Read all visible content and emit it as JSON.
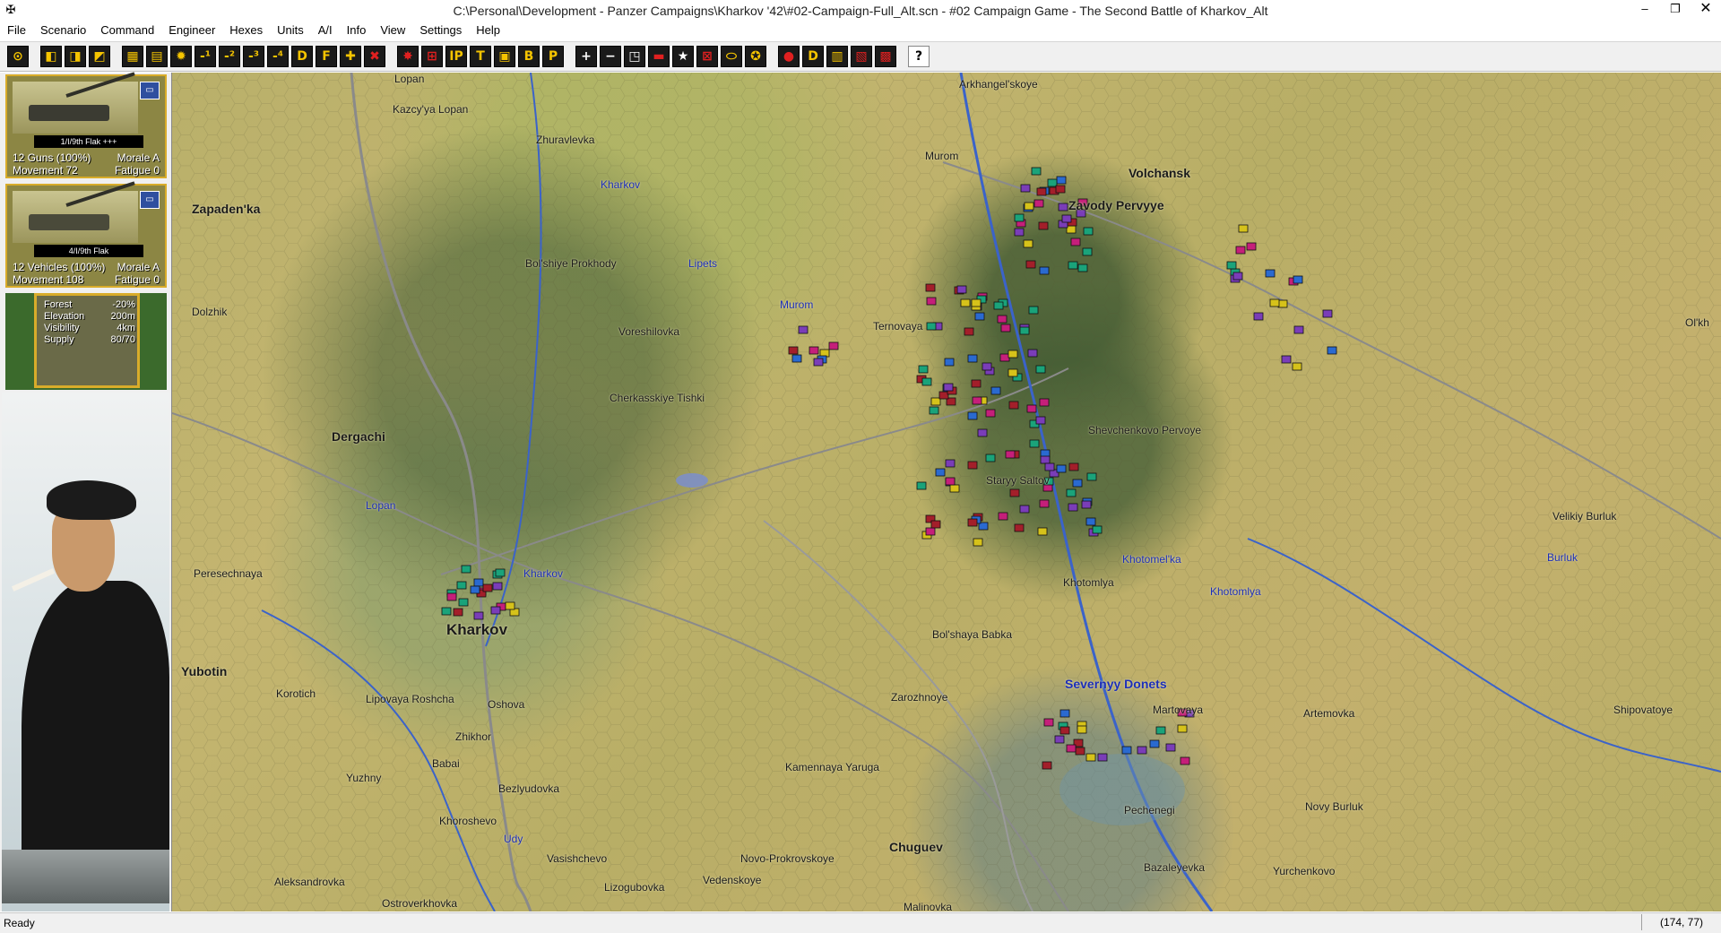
{
  "window": {
    "title": "C:\\Personal\\Development - Panzer Campaigns\\Kharkov '42\\#02-Campaign-Full_Alt.scn - #02 Campaign Game - The Second Battle of Kharkov_Alt",
    "minimize": "–",
    "restore": "❐",
    "close": "✕"
  },
  "menu": [
    "File",
    "Scenario",
    "Command",
    "Engineer",
    "Hexes",
    "Units",
    "A/I",
    "Info",
    "View",
    "Settings",
    "Help"
  ],
  "toolbar": {
    "group1": [
      "⊙",
      "◧",
      "◨",
      "◩",
      "▦",
      "▤",
      "✹",
      "-¹",
      "-²",
      "-³",
      "-⁴",
      "D",
      "F",
      "✚",
      "✖"
    ],
    "group2": [
      "✸",
      "⊞",
      "IP",
      "T",
      "▣",
      "B",
      "P"
    ],
    "group3": [
      "+",
      "−",
      "◳",
      "▬",
      "★",
      "⊠",
      "⬭",
      "✪"
    ],
    "group4": [
      "●",
      "D",
      "▥",
      "▧",
      "▩"
    ],
    "help": "?"
  },
  "units": [
    {
      "name": "1/I/9th Flak +++",
      "strength": "12 Guns (100%)",
      "morale": "Morale A",
      "movement": "Movement 72",
      "fatigue": "Fatigue 0"
    },
    {
      "name": "4/I/9th Flak",
      "strength": "12 Vehicles (100%)",
      "morale": "Morale A",
      "movement": "Movement 108",
      "fatigue": "Fatigue 0"
    }
  ],
  "terrain": {
    "forest_label": "Forest",
    "forest_value": "-20%",
    "elevation_label": "Elevation",
    "elevation_value": "200m",
    "visibility_label": "Visibility",
    "visibility_value": "4km",
    "supply_label": "Supply",
    "supply_value": "80/70"
  },
  "map": {
    "places": {
      "kazcyya_lopan": "Kazcy'ya Lopan",
      "zhuravlevka": "Zhuravlevka",
      "arkhangelskoye": "Arkhangel'skoye",
      "murom_town": "Murom",
      "volchansk": "Volchansk",
      "zavody_pervyye": "Zavody Pervyye",
      "zapadenka": "Zapaden'ka",
      "bolshiye_prokhody": "Bol'shiye Prokhody",
      "dolzhik": "Dolzhik",
      "voreshilovka": "Voreshilovka",
      "ternovaya": "Ternovaya",
      "oltkh": "Ol'kh",
      "cherkasskiye_tishki": "Cherkasskiye Tishki",
      "shevchenkovo_pervoye": "Shevchenkovo Pervoye",
      "dergachi": "Dergachi",
      "staryy_saltov": "Staryy Saltov",
      "velikiy_burluk": "Velikiy Burluk",
      "peresechnaya": "Peresechnaya",
      "khotomlya": "Khotomlya",
      "kharkov_city": "Kharkov",
      "bolshaya_babka": "Bol'shaya Babka",
      "yubotin": "Yubotin",
      "korotich": "Korotich",
      "lipovaya_roshcha": "Lipovaya Roshcha",
      "oshova": "Oshova",
      "zarozhnoye": "Zarozhnoye",
      "martovaya": "Martovaya",
      "artemovka": "Artemovka",
      "shipovatoye": "Shipovatoye",
      "zhikhor": "Zhikhor",
      "babai": "Babai",
      "kamennaya_yaruga": "Kamennaya Yaruga",
      "yuzhny": "Yuzhny",
      "bezlyudovka": "Bezlyudovka",
      "pechenegi": "Pechenegi",
      "novy_burluk": "Novy Burluk",
      "khoroshevo": "Khoroshevo",
      "chuguev": "Chuguev",
      "vasishchevo": "Vasishchevo",
      "novo_prokrovskoye": "Novo-Prokrovskoye",
      "bazaleyevka": "Bazaleyevka",
      "yurchenkovo": "Yurchenkovo",
      "aleksandrovka": "Aleksandrovka",
      "lizogubovka": "Lizogubovka",
      "vedenskoye": "Vedenskoye",
      "ostroverkhovka": "Ostroverkhovka",
      "malinovka": "Malinovka",
      "lopan_top": "Lopan"
    },
    "rivers": {
      "kharkov_river_n": "Kharkov",
      "lipets": "Lipets",
      "murom_river": "Murom",
      "lopan": "Lopan",
      "kharkov_river_s": "Kharkov",
      "khotomelka": "Khotomel'ka",
      "khotomlya_river": "Khotomlya",
      "burluk": "Burluk",
      "severnyy_donets": "Severnyy Donets",
      "udy": "Udy"
    }
  },
  "status": {
    "text": "Ready",
    "coords": "(174, 77)"
  }
}
